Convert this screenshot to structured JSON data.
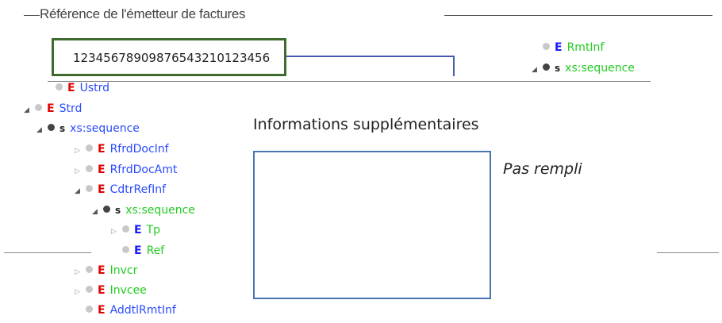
{
  "header": {
    "title": "Référence de l'émetteur de factures"
  },
  "reference": {
    "value": "12345678909876543210123456"
  },
  "tree_right": [
    {
      "arrow": "",
      "dot": "light",
      "kind": "E",
      "kind_color": "blue",
      "label": "RmtInf",
      "label_color": "green"
    },
    {
      "arrow": "◢",
      "dot": "dark",
      "kind": "s",
      "kind_color": "black",
      "label": "xs:sequence",
      "label_color": "green"
    }
  ],
  "tree_left": [
    {
      "arrow": "",
      "dot": "light",
      "kind": "E",
      "kind_color": "red",
      "label": "Ustrd",
      "label_color": "blue"
    },
    {
      "arrow": "◢",
      "dot": "light",
      "kind": "E",
      "kind_color": "red",
      "label": "Strd",
      "label_color": "blue"
    },
    {
      "arrow": "◢",
      "dot": "dark",
      "kind": "s",
      "kind_color": "black",
      "label": "xs:sequence",
      "label_color": "blue"
    },
    {
      "arrow": "▷",
      "dot": "light",
      "kind": "E",
      "kind_color": "red",
      "label": "RfrdDocInf",
      "label_color": "blue"
    },
    {
      "arrow": "▷",
      "dot": "light",
      "kind": "E",
      "kind_color": "red",
      "label": "RfrdDocAmt",
      "label_color": "blue"
    },
    {
      "arrow": "◢",
      "dot": "light",
      "kind": "E",
      "kind_color": "red",
      "label": "CdtrRefInf",
      "label_color": "blue"
    },
    {
      "arrow": "◢",
      "dot": "dark",
      "kind": "s",
      "kind_color": "black",
      "label": "xs:sequence",
      "label_color": "green"
    },
    {
      "arrow": "▷",
      "dot": "light",
      "kind": "E",
      "kind_color": "blue",
      "label": "Tp",
      "label_color": "green"
    },
    {
      "arrow": "",
      "dot": "light",
      "kind": "E",
      "kind_color": "blue",
      "label": "Ref",
      "label_color": "green"
    },
    {
      "arrow": "▷",
      "dot": "light",
      "kind": "E",
      "kind_color": "red",
      "label": "Invcr",
      "label_color": "green"
    },
    {
      "arrow": "▷",
      "dot": "light",
      "kind": "E",
      "kind_color": "red",
      "label": "Invcee",
      "label_color": "green"
    },
    {
      "arrow": "",
      "dot": "light",
      "kind": "E",
      "kind_color": "red",
      "label": "AddtlRmtInf",
      "label_color": "blue"
    }
  ],
  "info": {
    "title": "Informations supplémentaires",
    "status": "Pas rempli"
  },
  "colors": {
    "ref_box_border": "#3f6b2e",
    "info_box_border": "#4a74b0",
    "connector": "#4a5bb0"
  }
}
